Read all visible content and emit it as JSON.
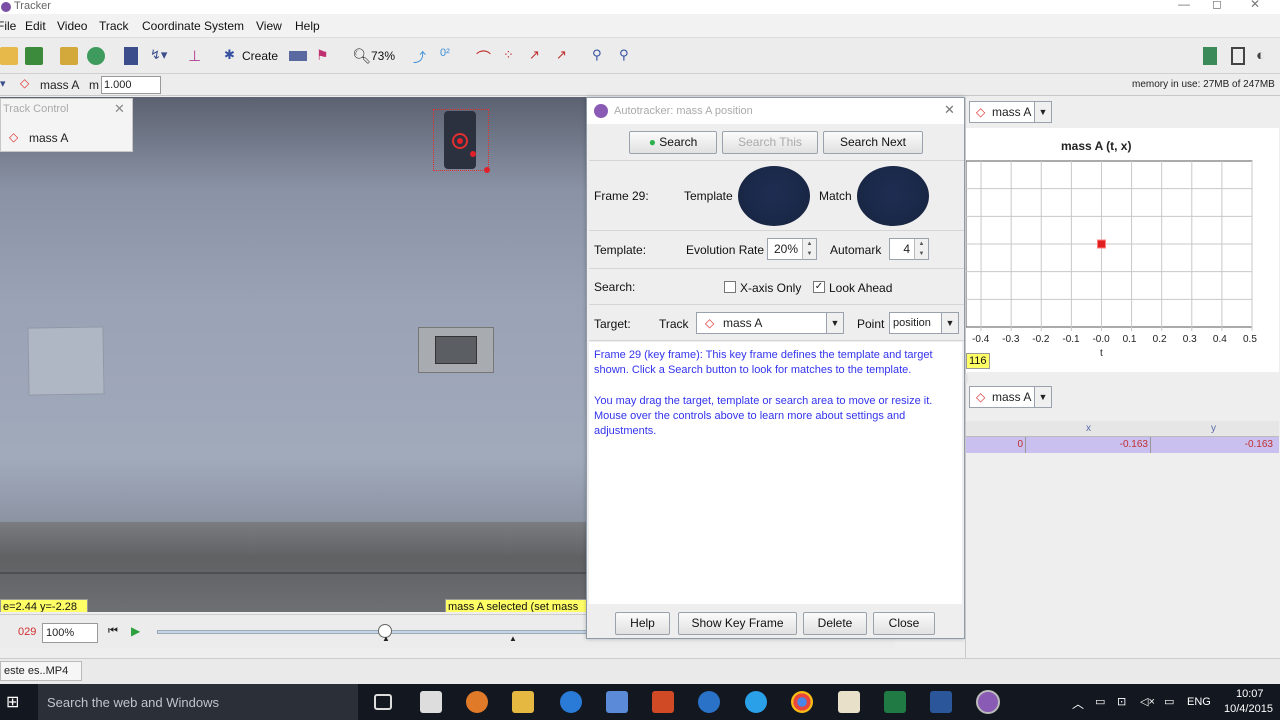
{
  "window": {
    "title": "Tracker"
  },
  "menu": [
    "File",
    "Edit",
    "Video",
    "Track",
    "Coordinate System",
    "View",
    "Help"
  ],
  "toolbar": {
    "create_label": "Create",
    "zoom_label": "73%"
  },
  "trackbar": {
    "track_name": "mass A",
    "mass_label": "m",
    "mass_value": "1.000",
    "memory": "memory in use: 27MB of 247MB"
  },
  "track_control": {
    "title": "Track Control",
    "item": "mass A"
  },
  "video_overlay": {
    "coords": "e=2.44  y=-2.28",
    "selected": "mass A selected (set mass"
  },
  "player": {
    "frame": "029",
    "rate": "100%"
  },
  "status": {
    "tab": "este es..MP4"
  },
  "dialog": {
    "title": "Autotracker: mass A position",
    "buttons": {
      "search": "Search",
      "search_this": "Search This",
      "search_next": "Search Next"
    },
    "frame_label": "Frame 29:",
    "template_label": "Template",
    "match_label": "Match",
    "template_row": {
      "label": "Template:",
      "evolution_label": "Evolution Rate",
      "evolution_value": "20%",
      "automark_label": "Automark",
      "automark_value": "4"
    },
    "search_row": {
      "label": "Search:",
      "xaxis_label": "X-axis Only",
      "xaxis_checked": false,
      "lookahead_label": "Look Ahead",
      "lookahead_checked": true
    },
    "target_row": {
      "label": "Target:",
      "track_label": "Track",
      "track_value": "mass A",
      "point_label": "Point",
      "point_value": "position"
    },
    "info": {
      "p1l1": "Frame 29 (key frame): This key frame defines the template and target",
      "p1l2": "shown. Click a Search button to look for matches to the template.",
      "p2l1": "You may drag the target, template or search area to move or resize it.",
      "p2l2": "Mouse over the controls above to learn more about settings and",
      "p2l3": "adjustments."
    },
    "footer": {
      "help": "Help",
      "show_key": "Show Key Frame",
      "delete": "Delete",
      "close": "Close"
    }
  },
  "plot": {
    "track": "mass A",
    "title": "mass A (t, x)",
    "xlabel": "t",
    "ticks": [
      "-0.4",
      "-0.3",
      "-0.2",
      "-0.1",
      "-0.0",
      "0.1",
      "0.2",
      "0.3",
      "0.4",
      "0.5"
    ],
    "tag": "116"
  },
  "chart_data": {
    "type": "scatter",
    "title": "mass A (t, x)",
    "xlabel": "t",
    "ylabel": "",
    "xlim": [
      -0.45,
      0.5
    ],
    "x": [
      0.0
    ],
    "y": [
      0.0
    ]
  },
  "table": {
    "track": "mass A",
    "headers": [
      "",
      "x",
      "y"
    ],
    "row": [
      "0",
      "-0.163",
      "-0.163"
    ]
  },
  "taskbar": {
    "search": "Search the web and Windows",
    "lang": "ENG",
    "time": "10:07",
    "date": "10/4/2015"
  }
}
